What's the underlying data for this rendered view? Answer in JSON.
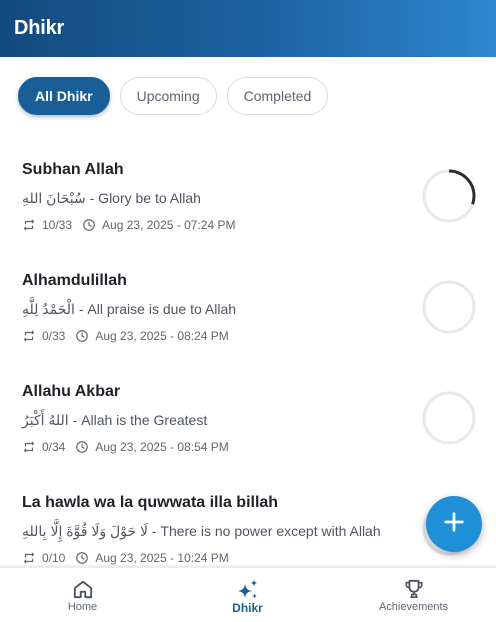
{
  "header": {
    "title": "Dhikr"
  },
  "filters": [
    {
      "label": "All Dhikr",
      "active": true
    },
    {
      "label": "Upcoming",
      "active": false
    },
    {
      "label": "Completed",
      "active": false
    }
  ],
  "dhikr_list": [
    {
      "name": "Subhan Allah",
      "description": "سُبْحَانَ اللهِ - Glory be to Allah",
      "count": "10/33",
      "datetime": "Aug 23, 2025 - 07:24 PM",
      "progress": 0.303
    },
    {
      "name": "Alhamdulillah",
      "description": "الْحَمْدُ لِلَّهِ - All praise is due to Allah",
      "count": "0/33",
      "datetime": "Aug 23, 2025 - 08:24 PM",
      "progress": 0
    },
    {
      "name": "Allahu Akbar",
      "description": "اللهُ أَكْبَرُ - Allah is the Greatest",
      "count": "0/34",
      "datetime": "Aug 23, 2025 - 08:54 PM",
      "progress": 0
    },
    {
      "name": "La hawla wa la quwwata illa billah",
      "description": "لَا حَوْلَ وَلَا قُوَّةَ إِلَّا بِاللهِ - There is no power except with Allah",
      "count": "0/10",
      "datetime": "Aug 23, 2025 - 10:24 PM",
      "progress": 0
    }
  ],
  "fab": {
    "icon": "plus-icon"
  },
  "bottom_nav": [
    {
      "label": "Home",
      "icon": "home-icon",
      "active": false
    },
    {
      "label": "Dhikr",
      "icon": "sparkles-icon",
      "active": true
    },
    {
      "label": "Achievements",
      "icon": "trophy-icon",
      "active": false
    }
  ],
  "colors": {
    "accent": "#1a5e97",
    "header_start": "#134a7d",
    "header_end": "#2f86cc",
    "fab": "#1f8fd8",
    "ring_track": "#e6e8eb",
    "ring_progress": "#2a2f36"
  }
}
